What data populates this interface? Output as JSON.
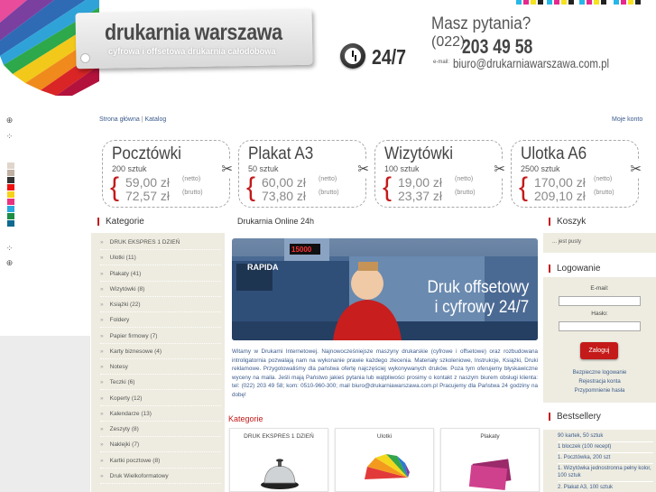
{
  "header": {
    "logo_title": "drukarnia warszawa",
    "logo_subtitle": "cyfrowa i offsetowa drukarnia całodobowa",
    "hours_badge": "24/7",
    "question": "Masz pytania?",
    "phone_prefix": "(022)",
    "phone_number": "203 49 58",
    "email_label": "e-mail:",
    "email": "biuro@drukarniawarszawa.com.pl"
  },
  "nav": {
    "home": "Strona główna",
    "separator": "|",
    "catalog": "Katalog",
    "my_account": "Moje konto"
  },
  "products": [
    {
      "title": "Pocztówki",
      "qty": "200 sztuk",
      "net": "59,00 zł",
      "gross": "72,57 zł"
    },
    {
      "title": "Plakat A3",
      "qty": "50 sztuk",
      "net": "60,00 zł",
      "gross": "73,80 zł"
    },
    {
      "title": "Wizytówki",
      "qty": "100 sztuk",
      "net": "19,00 zł",
      "gross": "23,37 zł"
    },
    {
      "title": "Ulotka A6",
      "qty": "2500 sztuk",
      "net": "170,00 zł",
      "gross": "209,10 zł"
    }
  ],
  "price_labels": {
    "net": "(netto)",
    "gross": "(brutto)"
  },
  "categories": {
    "heading": "Kategorie",
    "items": [
      "DRUK EKSPRES 1 DZIEŃ",
      "Ulotki (11)",
      "Plakaty (41)",
      "Wizytówki (8)",
      "Książki (22)",
      "Foldery",
      "Papier firmowy (7)",
      "Karty biznesowe (4)",
      "Notesy",
      "Teczki (6)",
      "Koperty (12)",
      "Kalendarze (13)",
      "Zeszyty (8)",
      "Naklejki (7)",
      "Kartki pocztowe (8)",
      "Druk Wielkoformatowy"
    ]
  },
  "main": {
    "heading": "Drukarnia Online 24h",
    "banner_line1": "Druk offsetowy",
    "banner_line2": "i cyfrowy 24/7",
    "banner_machine": "RAPIDA",
    "banner_counter": "15000",
    "intro": "Witamy w Drukarni Internetowej. Najnowocześniejsze maszyny drukarskie (cyfrowe i offsetowe) oraz rozbudowana introligatornia pozwalają nam na wykonanie prawie każdego zlecenia. Materiały szkoleniowe, Instrukcje, Książki, Druki reklamowe. Przygotowaliśmy dla państwa ofertę najczęściej wykonywanych druków. Poza tym oferujemy błyskawiczne wyceny na maila. Jeśli mają Państwo jakieś pytania lub wątpliwości prosimy o kontakt z naszym biurem obsługi klienta: tel: (022) 203 49 58; kom: 0510-960-300; mail biuro@drukarniawarszawa.com.pl Pracujemy dla Państwa 24 godziny na dobę!",
    "categories_heading": "Kategorie",
    "category_tiles": [
      "DRUK EKSPRES 1 DZIEŃ",
      "Ulotki",
      "Plakaty"
    ]
  },
  "cart": {
    "heading": "Koszyk",
    "empty_text": "... jest pusty"
  },
  "login": {
    "heading": "Logowanie",
    "email_label": "E-mail:",
    "password_label": "Hasło:",
    "button": "Zaloguj",
    "secure_login": "Bezpieczne logowanie",
    "register": "Rejestracja konta",
    "remind_password": "Przypomnienie hasła"
  },
  "bestsellers": {
    "heading": "Bestsellery",
    "items": [
      "90 kartek, 50 sztuk",
      "1 bloczek (100 recept)",
      "1. Pocztówka, 200 szt",
      "1. Wizytówka jednostronna pełny kolor, 100 sztuk",
      "2. Plakat A3, 100 sztuk"
    ]
  },
  "colors": {
    "accent_red": "#c41a1a",
    "link_blue": "#3a5a8c",
    "panel_beige": "#eeece0"
  }
}
